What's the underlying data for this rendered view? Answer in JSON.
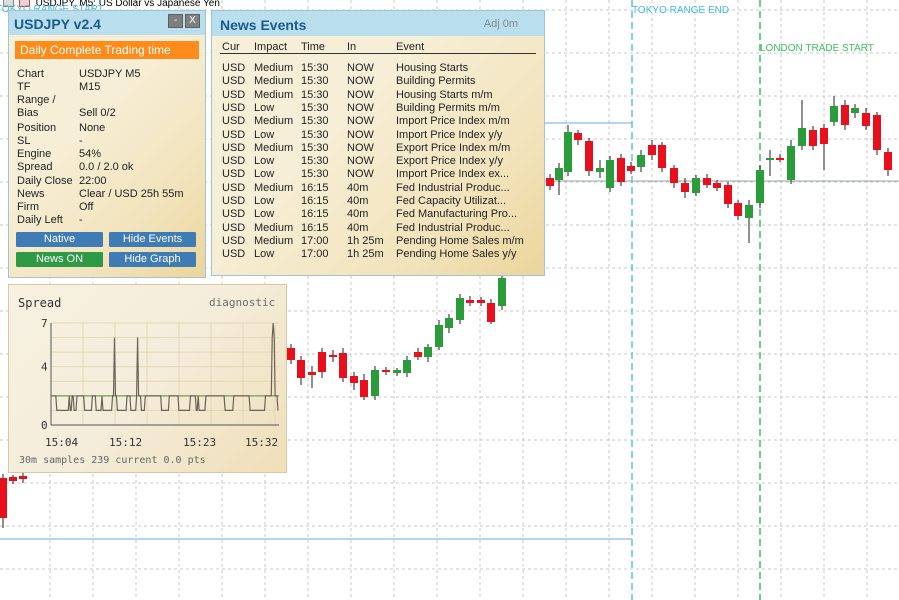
{
  "window": {
    "title": "USDJPY, M5:  US Dollar vs Japanese Yen"
  },
  "chart_markers": {
    "tokyo_start": "TOKYO RANGE START",
    "tokyo_end": "TOKYO RANGE END",
    "london_start": "LONDON TRADE START"
  },
  "info_panel": {
    "title": "USDJPY v2.4",
    "minimize": "-",
    "close": "X",
    "banner": "Daily Complete Trading time",
    "rows": [
      {
        "label": "Chart",
        "value": "USDJPY M5"
      },
      {
        "label": "TF",
        "value": "M15"
      },
      {
        "label": "Range / Bias",
        "value": "Sell 0/2"
      },
      {
        "label": "Position",
        "value": "None"
      },
      {
        "label": "SL",
        "value": "-"
      },
      {
        "label": "Engine",
        "value": "54%"
      },
      {
        "label": "Spread",
        "value": "0.0 / 2.0 ok"
      },
      {
        "label": "Daily Close",
        "value": "22:00"
      },
      {
        "label": "News",
        "value": "Clear / USD 25h 55m"
      },
      {
        "label": "Firm",
        "value": "Off"
      },
      {
        "label": "Daily Left",
        "value": "-"
      }
    ],
    "buttons": {
      "native": "Native",
      "hide_events": "Hide Events",
      "news_on": "News ON",
      "hide_graph": "Hide Graph"
    }
  },
  "news_panel": {
    "title": "News Events",
    "adj": "Adj 0m",
    "headers": [
      "Cur",
      "Impact",
      "Time",
      "In",
      "Event"
    ],
    "rows": [
      [
        "USD",
        "Medium",
        "15:30",
        "NOW",
        "Housing Starts"
      ],
      [
        "USD",
        "Medium",
        "15:30",
        "NOW",
        "Building Permits"
      ],
      [
        "USD",
        "Medium",
        "15:30",
        "NOW",
        "Housing Starts m/m"
      ],
      [
        "USD",
        "Low",
        "15:30",
        "NOW",
        "Building Permits m/m"
      ],
      [
        "USD",
        "Medium",
        "15:30",
        "NOW",
        "Import Price Index m/m"
      ],
      [
        "USD",
        "Low",
        "15:30",
        "NOW",
        "Import Price Index y/y"
      ],
      [
        "USD",
        "Medium",
        "15:30",
        "NOW",
        "Export Price Index m/m"
      ],
      [
        "USD",
        "Low",
        "15:30",
        "NOW",
        "Export Price Index y/y"
      ],
      [
        "USD",
        "Low",
        "15:30",
        "NOW",
        "Import Price Index ex..."
      ],
      [
        "USD",
        "Medium",
        "16:15",
        "40m",
        "Fed Industrial Produc..."
      ],
      [
        "USD",
        "Low",
        "16:15",
        "40m",
        "Fed Capacity Utilizat..."
      ],
      [
        "USD",
        "Low",
        "16:15",
        "40m",
        "Fed Manufacturing Pro..."
      ],
      [
        "USD",
        "Medium",
        "16:15",
        "40m",
        "Fed Industrial Produc..."
      ],
      [
        "USD",
        "Medium",
        "17:00",
        "1h 25m",
        "Pending Home Sales m/m"
      ],
      [
        "USD",
        "Low",
        "17:00",
        "1h 25m",
        "Pending Home Sales y/y"
      ]
    ]
  },
  "spread_panel": {
    "title": "Spread",
    "subtitle": "diagnostic",
    "y_ticks": [
      "7",
      "4",
      "0"
    ],
    "x_ticks": [
      "15:04",
      "15:12",
      "15:23",
      "15:32"
    ],
    "footer": "30m samples 239   current 0.0 pts",
    "series": [
      2,
      2,
      2,
      2,
      2,
      1,
      1,
      1,
      1,
      1,
      1,
      1,
      1,
      1,
      1,
      1,
      1,
      1,
      2,
      1,
      1,
      2,
      2,
      1,
      1,
      1,
      2,
      2,
      2,
      2,
      2,
      2,
      2,
      2,
      1,
      1,
      1,
      1,
      1,
      1,
      1,
      1,
      2,
      2,
      2,
      2,
      1,
      1,
      1,
      1,
      1,
      1,
      2,
      1,
      1,
      1,
      1,
      1,
      1,
      1,
      1,
      1,
      1,
      2,
      2,
      6,
      2,
      2,
      1,
      1,
      1,
      1,
      1,
      1,
      1,
      1,
      1,
      1,
      2,
      2,
      2,
      2,
      1,
      1,
      1,
      1,
      1,
      1,
      2,
      6,
      2,
      2,
      2,
      1,
      1,
      1,
      1,
      2,
      2,
      2,
      2,
      2,
      2,
      2,
      2,
      2,
      2,
      2,
      2,
      2,
      2,
      2,
      2,
      2,
      1,
      1,
      1,
      1,
      1,
      1,
      1,
      1,
      2,
      2,
      2,
      2,
      2,
      2,
      2,
      2,
      2,
      2,
      1,
      1,
      1,
      1,
      1,
      1,
      1,
      1,
      1,
      1,
      1,
      1,
      2,
      2,
      2,
      2,
      2,
      2,
      1,
      1,
      2,
      1,
      1,
      1,
      1,
      1,
      1,
      1,
      2,
      2,
      2,
      2,
      2,
      2,
      2,
      2,
      2,
      2,
      2,
      2,
      2,
      2,
      2,
      2,
      2,
      2,
      2,
      2,
      1,
      1,
      1,
      1,
      1,
      1,
      1,
      1,
      1,
      2,
      2,
      2,
      2,
      2,
      2,
      2,
      2,
      2,
      2,
      2,
      2,
      2,
      2,
      2,
      2,
      2,
      1,
      1,
      1,
      1,
      1,
      1,
      1,
      1,
      1,
      1,
      1,
      1,
      1,
      1,
      1,
      1,
      2,
      2,
      2,
      2,
      2,
      2,
      2,
      6,
      7,
      6,
      2,
      2,
      2,
      1
    ]
  },
  "colors": {
    "bull": "#2a9d3a",
    "bear": "#e8101c",
    "session_line": "#5bc4d8",
    "london_line": "#3fbf5f",
    "range_line": "#6aa9e0",
    "panel_header": "#b9dfee",
    "banner": "#ff8c1a"
  }
}
